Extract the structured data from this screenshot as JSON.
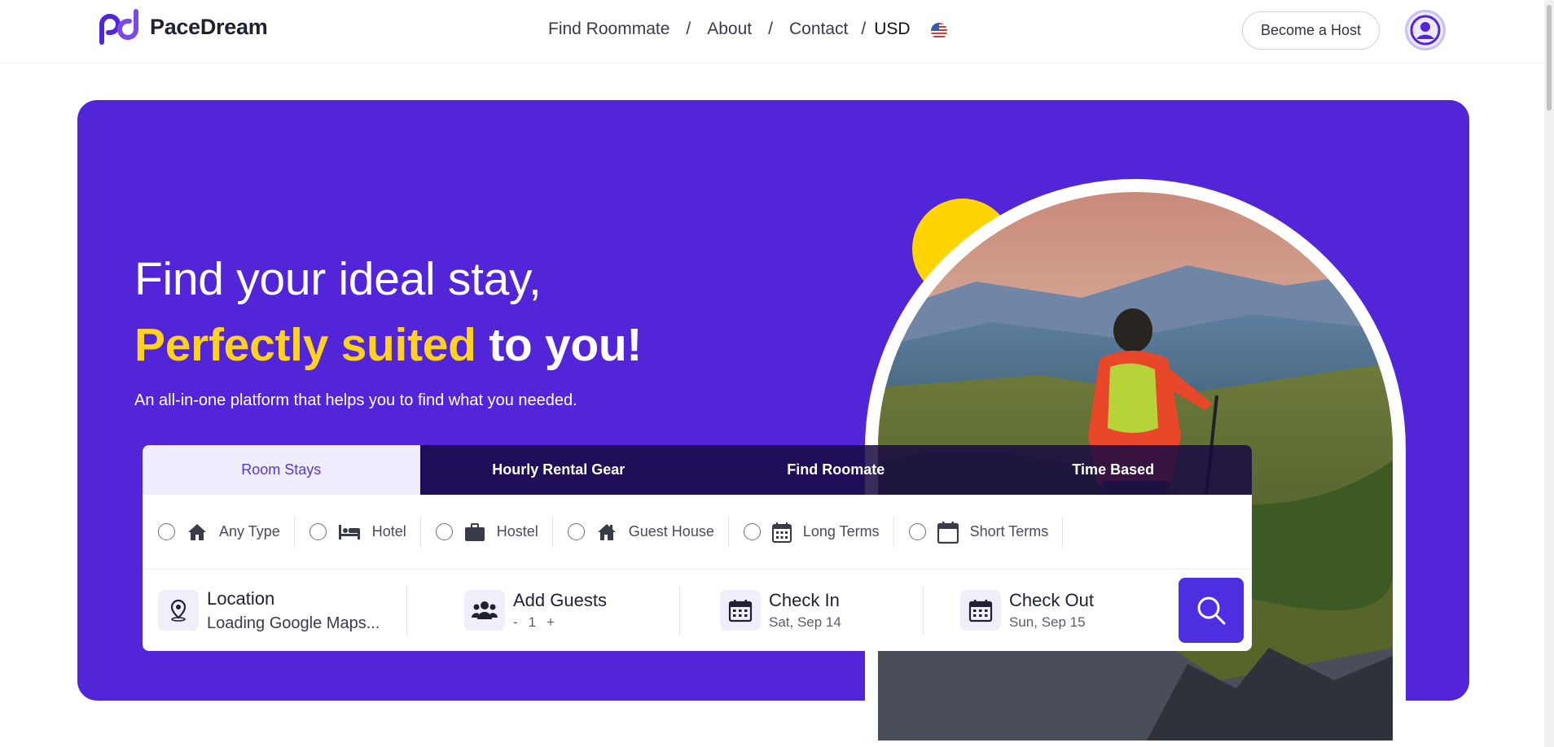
{
  "brand": {
    "name": "PaceDream",
    "primary_color": "#5226d8",
    "accent_color": "#ffd21f"
  },
  "nav": {
    "items": [
      "Find Roommate",
      "About",
      "Contact"
    ],
    "separator": "/",
    "currency": "USD",
    "flag_icon": "us-flag-icon"
  },
  "header": {
    "host_button": "Become a Host",
    "avatar_icon": "user-avatar-icon"
  },
  "hero": {
    "headline_line1": "Find your ideal stay,",
    "headline_accent": "Perfectly suited",
    "headline_rest": " to you!",
    "subtitle": "An all-in-one platform that helps you to find what you needed."
  },
  "search": {
    "tabs": [
      {
        "label": "Room Stays",
        "active": true
      },
      {
        "label": "Hourly Rental Gear",
        "active": false
      },
      {
        "label": "Find Roomate",
        "active": false
      },
      {
        "label": "Time Based",
        "active": false
      }
    ],
    "types": [
      {
        "label": "Any Type",
        "icon": "home-icon"
      },
      {
        "label": "Hotel",
        "icon": "bed-icon"
      },
      {
        "label": "Hostel",
        "icon": "briefcase-icon"
      },
      {
        "label": "Guest House",
        "icon": "house-icon"
      },
      {
        "label": "Long Terms",
        "icon": "calendar-grid-icon"
      },
      {
        "label": "Short Terms",
        "icon": "calendar-icon"
      }
    ],
    "location": {
      "title": "Location",
      "value": "Loading Google Maps..."
    },
    "guests": {
      "title": "Add Guests",
      "minus": "-",
      "count": "1",
      "plus": "+"
    },
    "check_in": {
      "title": "Check In",
      "date": "Sat, Sep 14"
    },
    "check_out": {
      "title": "Check Out",
      "date": "Sun, Sep 15"
    },
    "search_icon": "search-icon"
  }
}
